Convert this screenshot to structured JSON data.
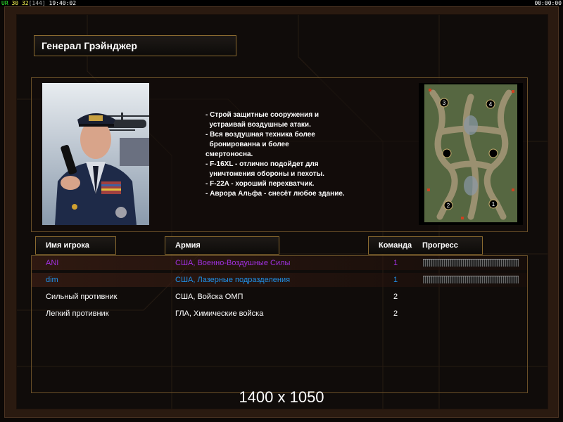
{
  "topbar": {
    "ur": "UR",
    "n1": "30",
    "n2": "32",
    "n3": "[144]",
    "clock": "19:40:02",
    "timer": "00:00:00"
  },
  "general": {
    "title": "Генерал Грэйнджер",
    "description": [
      "- Строй защитные сооружения и",
      "  устраивай воздушные атаки.",
      "- Вся воздушная техника более",
      "  бронированна и более",
      "смертоносна.",
      "- F-16XL - отлично подойдет для",
      "  уничтожения обороны и пехоты.",
      "- F-22A - хороший перехватчик.",
      "- Аврора Альфа - снесёт любое здание."
    ]
  },
  "map": {
    "start_labels": [
      "3",
      "4",
      "2",
      "1"
    ]
  },
  "columns": {
    "player_name": "Имя игрока",
    "army": "Армия",
    "team": "Команда",
    "progress": "Прогресс"
  },
  "players": [
    {
      "name": "ANI",
      "army": "США, Военно-Воздушные Силы",
      "team": "1",
      "color": "#a030e0",
      "progress": 1.0
    },
    {
      "name": "dim",
      "army": "США, Лазерные подразделения",
      "team": "1",
      "color": "#2090e8",
      "progress": 1.0
    },
    {
      "name": "Сильный противник",
      "army": "США, Войска ОМП",
      "team": "2",
      "color": "#ffffff"
    },
    {
      "name": "Легкий противник",
      "army": "ГЛА, Химические войска",
      "team": "2",
      "color": "#ffffff"
    }
  ],
  "overlay": {
    "resolution": "1400 x 1050"
  }
}
